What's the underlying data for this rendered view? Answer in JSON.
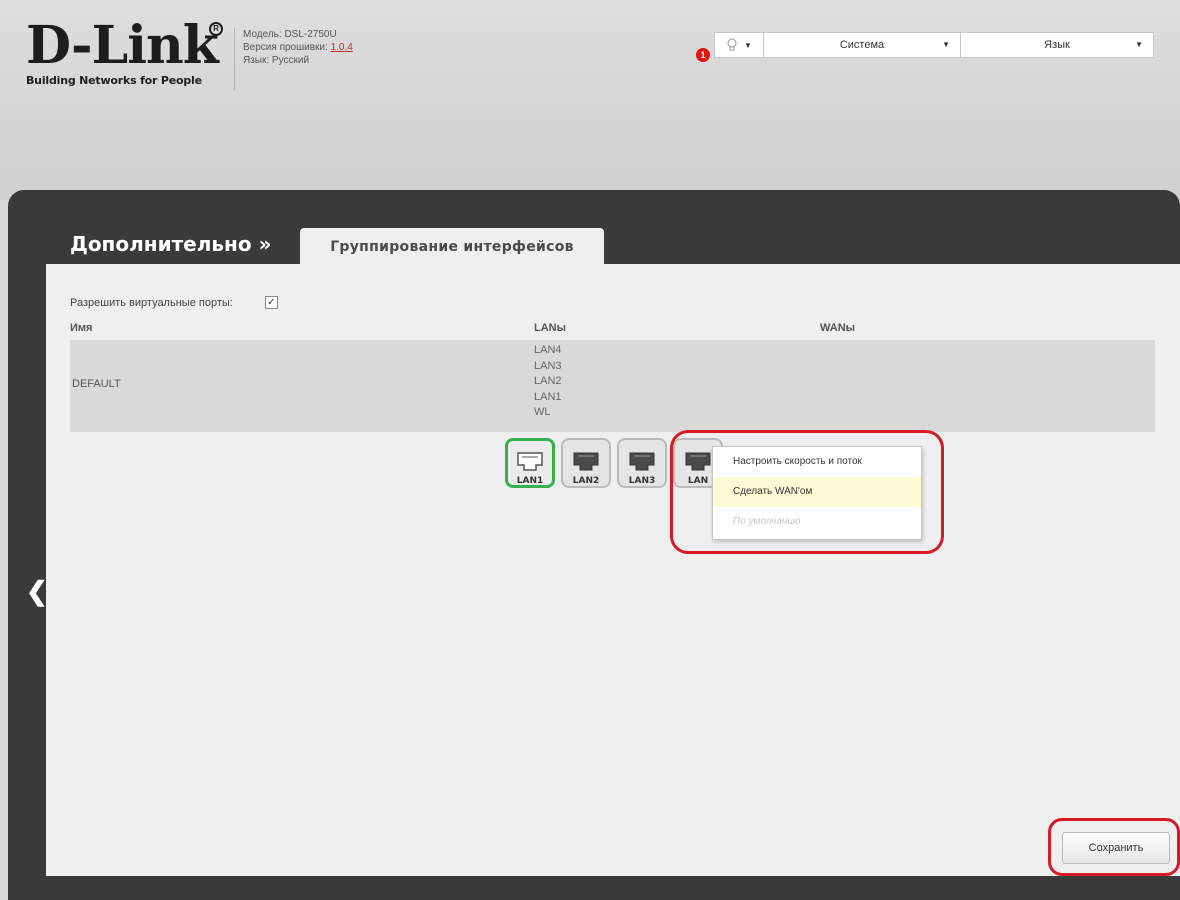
{
  "brand": {
    "logo_text": "D-Link",
    "registered": "R",
    "tagline": "Building Networks for People"
  },
  "device": {
    "model": "Модель: DSL-2750U",
    "firmware_label": "Версия прошивки: ",
    "firmware_version": "1.0.4",
    "language": "Язык: Русский"
  },
  "topbar": {
    "notification_count": "1",
    "bulb_icon": "lightbulb-icon",
    "system_label": "Система",
    "language_label": "Язык"
  },
  "breadcrumb": {
    "section": "Дополнительно »",
    "page": "Группирование интерфейсов"
  },
  "form": {
    "virtual_ports_label": "Разрешить виртуальные порты:",
    "virtual_ports_checked": true,
    "check_mark": "✓"
  },
  "table": {
    "headers": {
      "name": "Имя",
      "lans": "LANы",
      "wans": "WANы"
    },
    "rows": [
      {
        "name": "DEFAULT",
        "lans": [
          "LAN4",
          "LAN3",
          "LAN2",
          "LAN1",
          "WL"
        ],
        "wans": []
      }
    ]
  },
  "ports": [
    {
      "label": "LAN1",
      "active": true
    },
    {
      "label": "LAN2",
      "active": false
    },
    {
      "label": "LAN3",
      "active": false
    },
    {
      "label": "LAN",
      "active": false
    }
  ],
  "context_menu": {
    "items": [
      {
        "label": "Настроить скорость и поток",
        "state": "normal"
      },
      {
        "label": "Сделать WAN'ом",
        "state": "highlighted"
      },
      {
        "label": "По умолчанию",
        "state": "disabled"
      }
    ]
  },
  "actions": {
    "save_label": "Сохранить"
  },
  "colors": {
    "annotation_red": "#d51b23",
    "active_port_green": "#37b052",
    "frame_dark": "#3a3a3a"
  }
}
